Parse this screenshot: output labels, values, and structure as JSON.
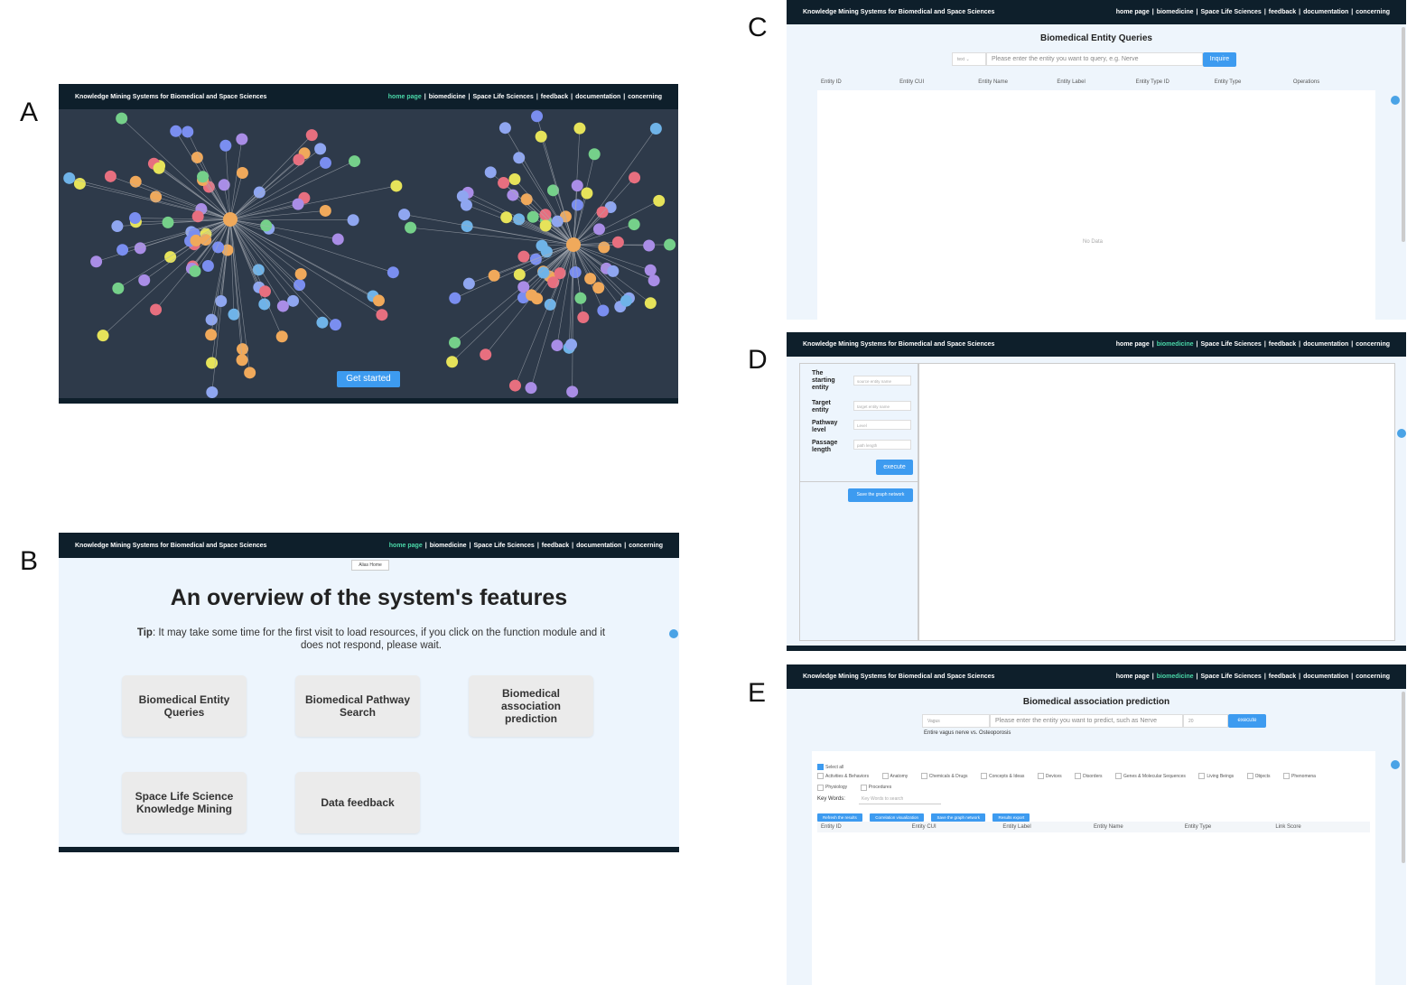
{
  "labels": {
    "a": "A",
    "b": "B",
    "c": "C",
    "d": "D",
    "e": "E"
  },
  "header": {
    "title": "Knowledge Mining Systems for Biomedical and Space Sciences",
    "nav": [
      "home page",
      "|",
      "biomedicine",
      "|",
      "Space Life Sciences",
      "|",
      "feedback",
      "|",
      "documentation",
      "|",
      "concerning"
    ]
  },
  "colors": {
    "topbar": "#0e1f2b",
    "accent": "#3d9bf0",
    "active_nav": "#4ad7a8",
    "graph_bg": "#2e3a4a"
  },
  "panel_a": {
    "get_started": "Get started"
  },
  "panel_b": {
    "alias_tab": "Alias Home",
    "title": "An overview of the system's features",
    "tip_label": "Tip",
    "tip_text": ": It may take some time for the first visit to load resources, if you click on the function module and it does not respond, please wait.",
    "cards": [
      "Biomedical Entity Queries",
      "Biomedical Pathway Search",
      "Biomedical association prediction",
      "Space Life Science Knowledge Mining",
      "Data feedback"
    ]
  },
  "panel_c": {
    "title": "Biomedical Entity Queries",
    "select_value": "text",
    "input_placeholder": "Please enter the entity you want to query, e.g. Nerve",
    "button": "Inquire",
    "columns": [
      "Entity ID",
      "Entity CUI",
      "Entity Name",
      "Entity Label",
      "Entity Type ID",
      "Entity Type",
      "Operations"
    ],
    "empty_text": "No Data"
  },
  "panel_d": {
    "fields": [
      {
        "label": "The starting entity",
        "placeholder": "source entity name"
      },
      {
        "label": "Target entity",
        "placeholder": "target entity name"
      },
      {
        "label": "Pathway level",
        "placeholder": "Level"
      },
      {
        "label": "Passage length",
        "placeholder": "path length"
      }
    ],
    "execute": "execute",
    "save_graph": "Save the graph network"
  },
  "panel_e": {
    "title": "Biomedical association prediction",
    "select_value": "Vagus",
    "input_placeholder": "Please enter the entity you want to predict, such as Nerve",
    "count_value": "20",
    "button": "execute",
    "hint": "Entire vagus nerve vs. Osteoporosis",
    "select_all": "Select all",
    "categories": [
      "Activities & Behaviors",
      "Anatomy",
      "Chemicals & Drugs",
      "Concepts & Ideas",
      "Devices",
      "Disorders",
      "Genes & Molecular Sequences",
      "Living Beings",
      "Objects",
      "Phenomena",
      "Physiology",
      "Procedures"
    ],
    "keywords_label": "Key Words:",
    "keywords_placeholder": "Key Words to search",
    "buttons": [
      "Refresh the results",
      "Correlation visualization",
      "Save the graph network",
      "Results export"
    ],
    "columns": [
      "Entity ID",
      "Entity CUI",
      "Entity Label",
      "Entity Name",
      "Entity Type",
      "Link Score"
    ]
  }
}
